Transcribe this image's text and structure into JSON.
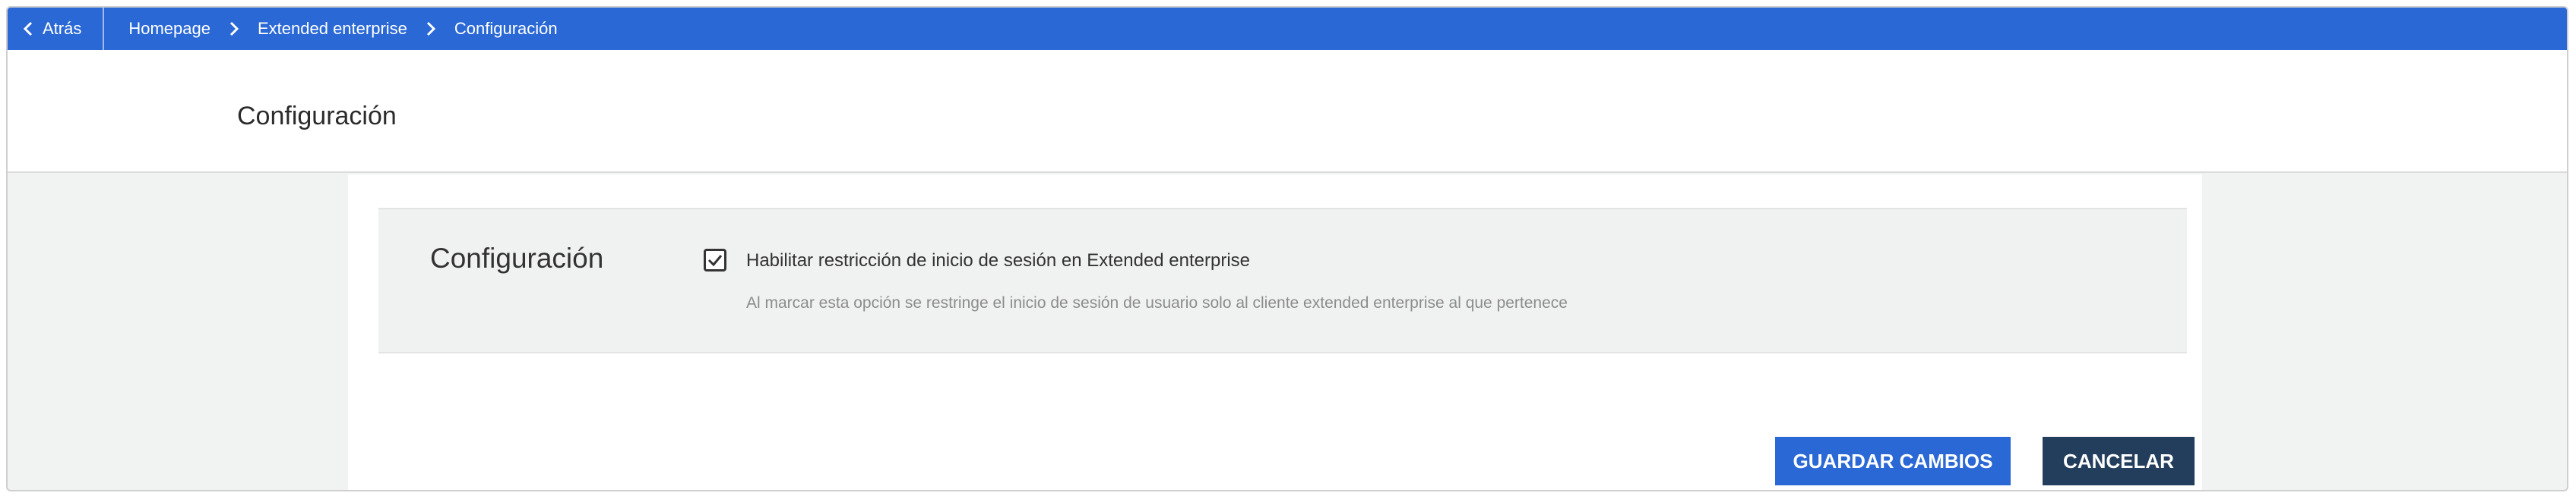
{
  "breadcrumb": {
    "back_label": "Atrás",
    "items": [
      "Homepage",
      "Extended enterprise",
      "Configuración"
    ]
  },
  "header": {
    "title": "Configuración"
  },
  "settings": {
    "section_title": "Configuración",
    "checkbox_label": "Habilitar restricción de inicio de sesión en Extended enterprise",
    "checkbox_checked": true,
    "help_text": "Al marcar esta opción se restringe el inicio de sesión de usuario solo al cliente extended enterprise al que pertenece"
  },
  "actions": {
    "save_label": "GUARDAR CAMBIOS",
    "cancel_label": "CANCELAR"
  },
  "colors": {
    "accent": "#2a68d6",
    "cancel": "#233d5c"
  }
}
